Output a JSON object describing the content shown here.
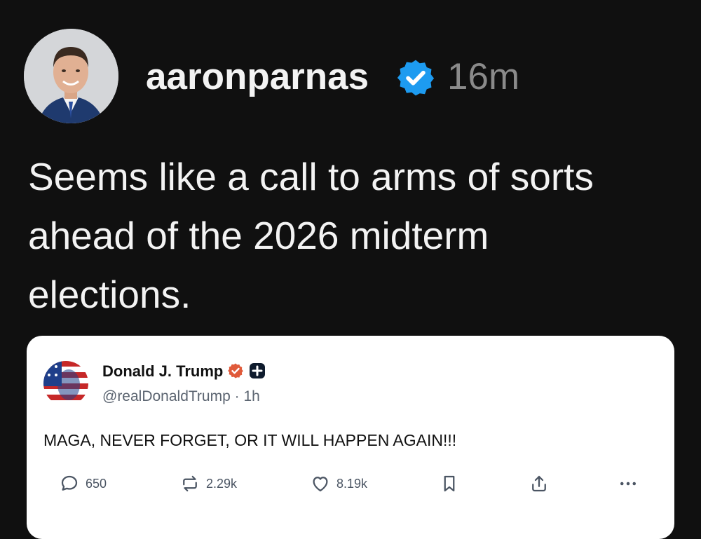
{
  "post": {
    "username": "aaronparnas",
    "time": "16m",
    "text": "Seems like a call to arms of sorts ahead of the 2026 midterm elections.",
    "verified_icon": "verified-badge-icon",
    "accent_color": "#1d9bf0"
  },
  "quoted": {
    "name": "Donald J. Trump",
    "handle_time": "@realDonaldTrump · 1h",
    "text": "MAGA, NEVER FORGET, OR IT WILL HAPPEN AGAIN!!!",
    "actions": {
      "replies": "650",
      "reposts": "2.29k",
      "likes": "8.19k"
    },
    "verified_color": "#e05a3a"
  }
}
